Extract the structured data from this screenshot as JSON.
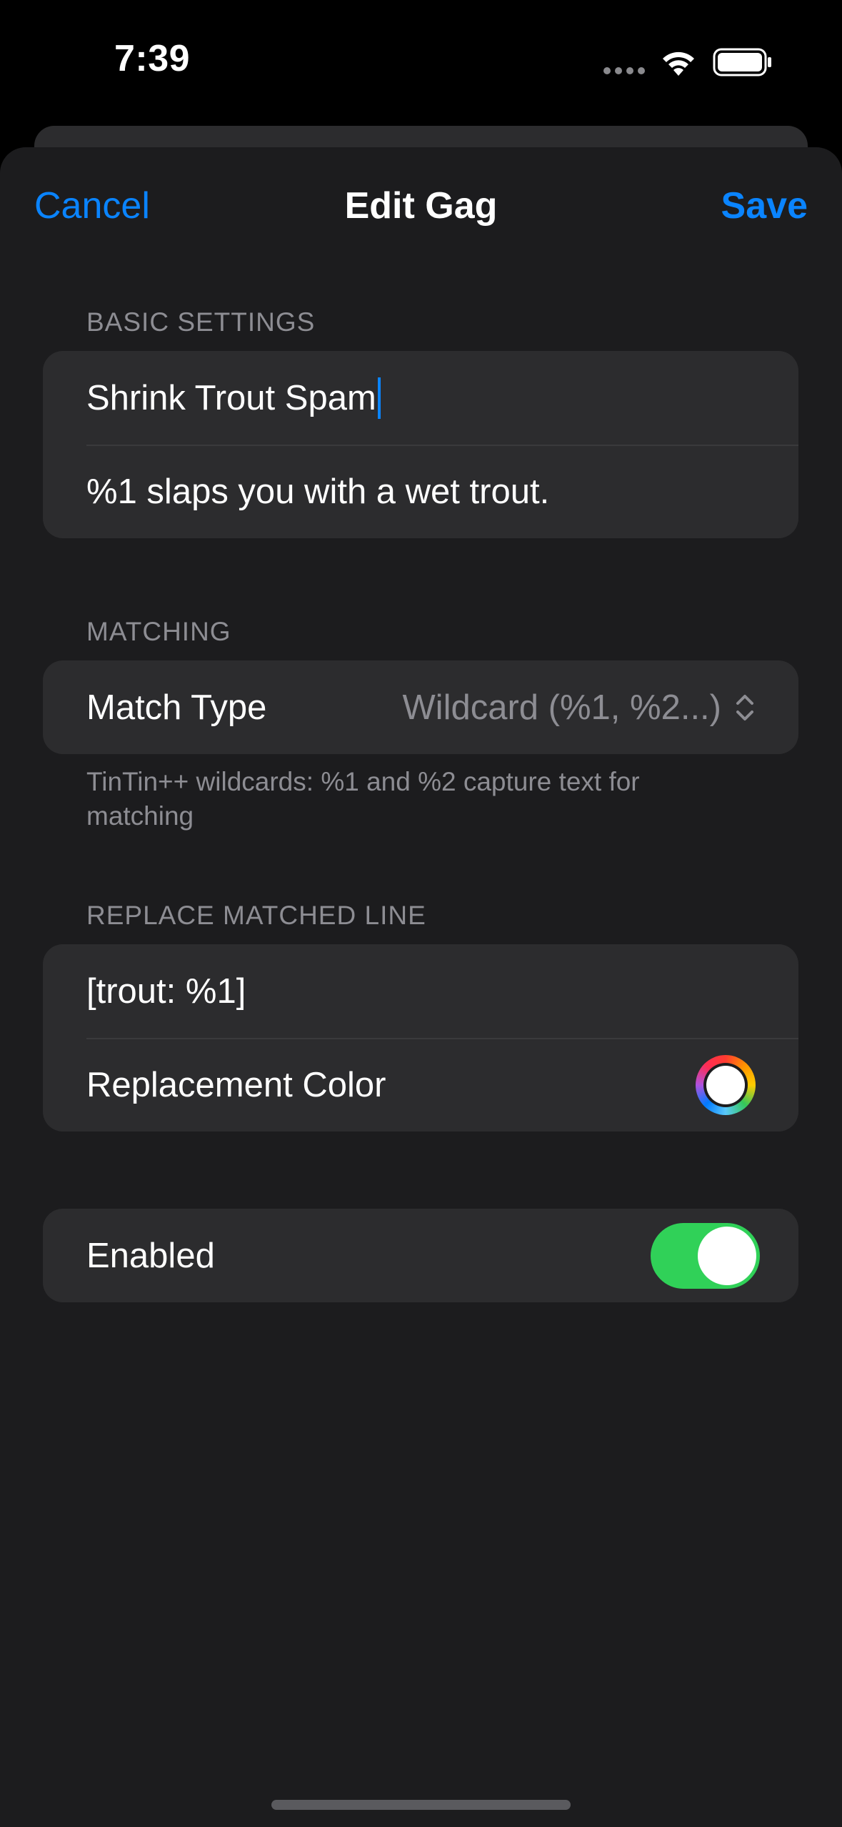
{
  "status_bar": {
    "time": "7:39"
  },
  "nav": {
    "cancel_label": "Cancel",
    "title": "Edit Gag",
    "save_label": "Save"
  },
  "basic_settings": {
    "header": "BASIC SETTINGS",
    "name_value": "Shrink Trout Spam",
    "pattern_value": "%1 slaps you with a wet trout."
  },
  "matching": {
    "header": "MATCHING",
    "match_type_label": "Match Type",
    "match_type_value": "Wildcard (%1, %2...)",
    "footer": "TinTin++ wildcards: %1 and %2 capture text for matching"
  },
  "replace": {
    "header": "REPLACE MATCHED LINE",
    "replacement_value": "[trout: %1]",
    "color_label": "Replacement Color",
    "color_value": "#ffffff"
  },
  "enabled": {
    "label": "Enabled",
    "on": true
  },
  "colors": {
    "accent": "#0a84ff",
    "toggle_on": "#30d158",
    "background": "#1c1c1e",
    "cell": "#2c2c2e"
  }
}
